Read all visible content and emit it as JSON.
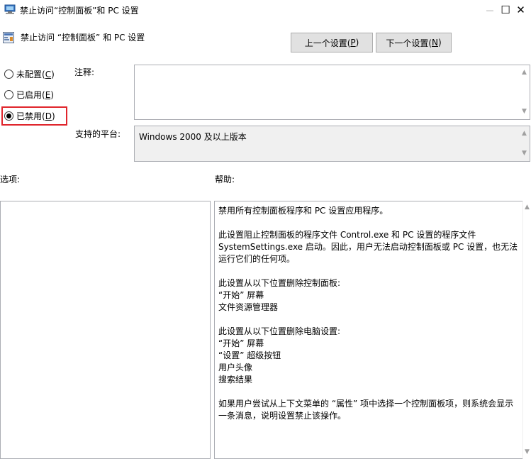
{
  "window": {
    "title": "禁止访问“控制面板”和 PC 设置",
    "minimize": "—",
    "maximize": "☐",
    "close": "✕"
  },
  "header": {
    "title": "禁止访问 “控制面板” 和 PC 设置",
    "prev_label": "上一个设置(",
    "prev_key": "P",
    "prev_close": ")",
    "next_label": "下一个设置(",
    "next_key": "N",
    "next_close": ")"
  },
  "state": {
    "options": [
      {
        "label": "未配置(",
        "key": "C",
        "close": ")",
        "selected": false
      },
      {
        "label": "已启用(",
        "key": "E",
        "close": ")",
        "selected": false
      },
      {
        "label": "已禁用(",
        "key": "D",
        "close": ")",
        "selected": true
      }
    ]
  },
  "comment": {
    "label": "注释:",
    "value": ""
  },
  "platform": {
    "label": "支持的平台:",
    "value": "Windows 2000 及以上版本"
  },
  "options_panel": {
    "label": "选项:"
  },
  "help": {
    "label": "帮助:",
    "paragraphs": [
      [
        "禁用所有控制面板程序和 PC 设置应用程序。"
      ],
      [
        "此设置阻止控制面板的程序文件 Control.exe 和 PC 设置的程序文件 SystemSettings.exe 启动。因此，用户无法启动控制面板或 PC 设置，也无法运行它们的任何项。"
      ],
      [
        "此设置从以下位置删除控制面板:",
        " “开始” 屏幕",
        "文件资源管理器"
      ],
      [
        "此设置从以下位置删除电脑设置:",
        " “开始” 屏幕",
        " “设置” 超级按钮",
        "用户头像",
        "搜索结果"
      ],
      [
        "如果用户尝试从上下文菜单的 “属性” 项中选择一个控制面板项，则系统会显示一条消息，说明设置禁止该操作。"
      ]
    ]
  },
  "icons": {
    "app": "policy-app-icon",
    "header": "policy-setting-icon",
    "scroll_up": "▲",
    "scroll_down": "▼"
  },
  "colors": {
    "highlight": "#e0252c",
    "button_bg": "#e1e1e1",
    "readonly_bg": "#f0f0f0"
  }
}
